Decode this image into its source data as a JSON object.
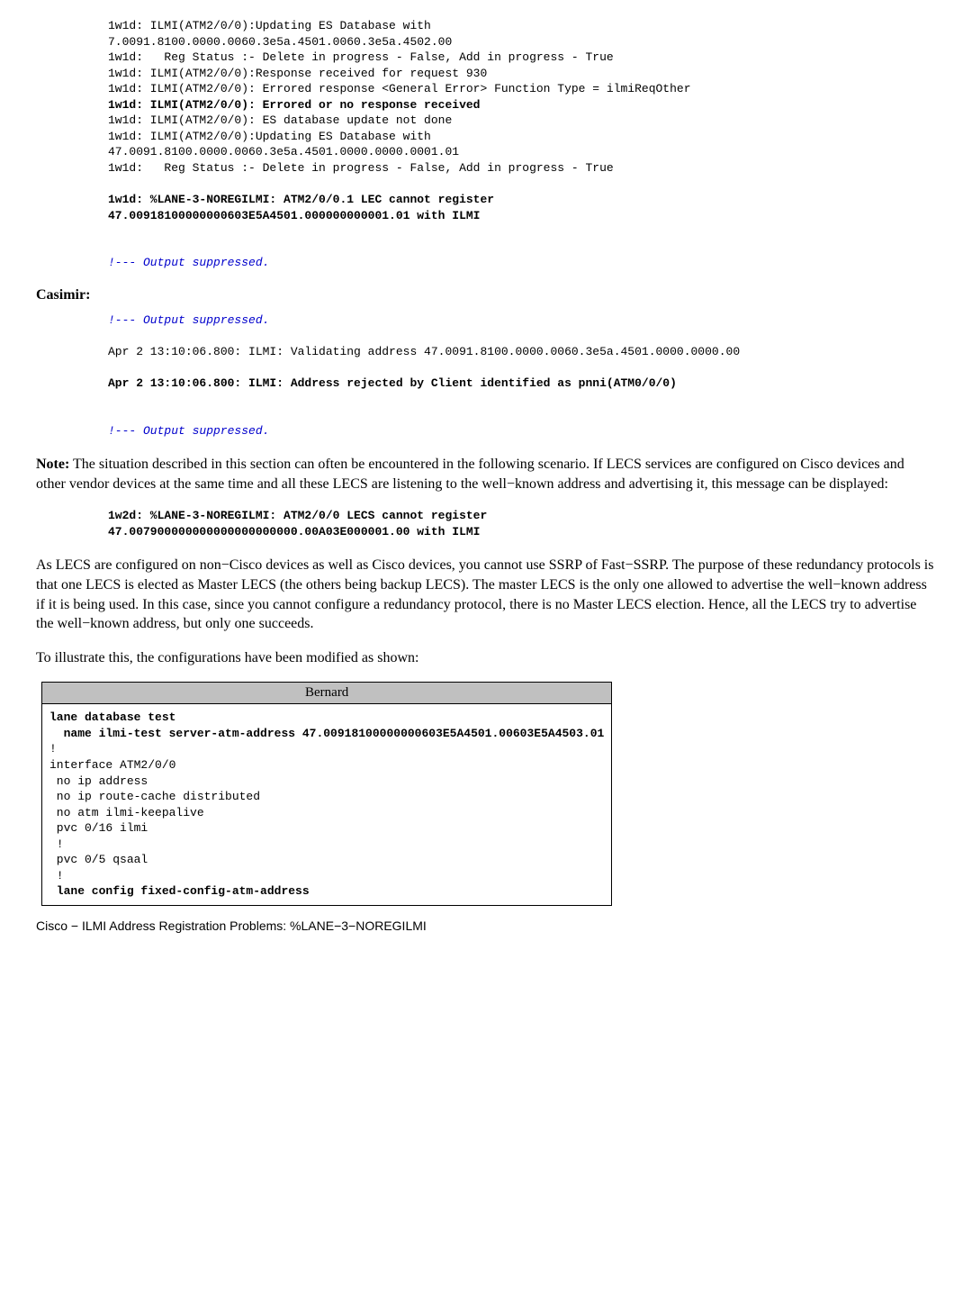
{
  "block1": {
    "l1": "1w1d: ILMI(ATM2/0/0):Updating ES Database with",
    "l2": "7.0091.8100.0000.0060.3e5a.4501.0060.3e5a.4502.00",
    "l3": "1w1d:   Reg Status :- Delete in progress - False, Add in progress - True",
    "l4": "1w1d: ILMI(ATM2/0/0):Response received for request 930",
    "l5": "1w1d: ILMI(ATM2/0/0): Errored response <General Error> Function Type = ilmiReqOther",
    "l6": "1w1d: ILMI(ATM2/0/0): Errored or no response received",
    "l7": "1w1d: ILMI(ATM2/0/0): ES database update not done",
    "l8": "1w1d: ILMI(ATM2/0/0):Updating ES Database with",
    "l9": "47.0091.8100.0000.0060.3e5a.4501.0000.0000.0001.01",
    "l10": "1w1d:   Reg Status :- Delete in progress - False, Add in progress - True",
    "l11": "1w1d: %LANE-3-NOREGILMI: ATM2/0/0.1 LEC cannot register",
    "l12": "47.00918100000000603E5A4501.000000000001.01 with ILMI",
    "suppressed": "!--- Output suppressed."
  },
  "casimir_heading": "Casimir:",
  "block2": {
    "suppressed1": "!--- Output suppressed.",
    "l1": "Apr 2 13:10:06.800: ILMI: Validating address 47.0091.8100.0000.0060.3e5a.4501.0000.0000.00",
    "l2": "Apr 2 13:10:06.800: ILMI: Address rejected by Client identified as pnni(ATM0/0/0)",
    "suppressed2": "!--- Output suppressed."
  },
  "note_para": "Note: The situation described in this section can often be encountered in the following scenario. If LECS services are configured on Cisco devices and other vendor devices at the same time and all these LECS are listening to the well−known address and advertising it, this message can be displayed:",
  "note_label": "Note:",
  "note_rest": " The situation described in this section can often be encountered in the following scenario. If LECS services are configured on Cisco devices and other vendor devices at the same time and all these LECS are listening to the well−known address and advertising it, this message can be displayed:",
  "block3": {
    "l1": "1w2d: %LANE-3-NOREGILMI: ATM2/0/0 LECS cannot register",
    "l2": "47.007900000000000000000000.00A03E000001.00 with ILMI"
  },
  "para2": "As LECS are configured on non−Cisco devices as well as Cisco devices, you cannot use SSRP of Fast−SSRP. The purpose of these redundancy protocols is that one LECS is elected as Master LECS (the others being backup LECS). The master LECS is the only one allowed to advertise the well−known address if it is being used. In this case, since you cannot configure a redundancy protocol, there is no Master LECS election. Hence, all the LECS try to advertise the well−known address, but only one succeeds.",
  "para3": "To illustrate this, the configurations have been modified as shown:",
  "table": {
    "header": "Bernard",
    "l1": "lane database test",
    "l2": "  name ilmi-test server-atm-address 47.00918100000000603E5A4501.00603E5A4503.01",
    "l3": "!",
    "l4": "interface ATM2/0/0",
    "l5": " no ip address",
    "l6": " no ip route-cache distributed",
    "l7": " no atm ilmi-keepalive",
    "l8": " pvc 0/16 ilmi",
    "l9": " !",
    "l10": " pvc 0/5 qsaal",
    "l11": " !",
    "l12": " lane config fixed-config-atm-address"
  },
  "footer": "Cisco − ILMI Address Registration Problems: %LANE−3−NOREGILMI"
}
